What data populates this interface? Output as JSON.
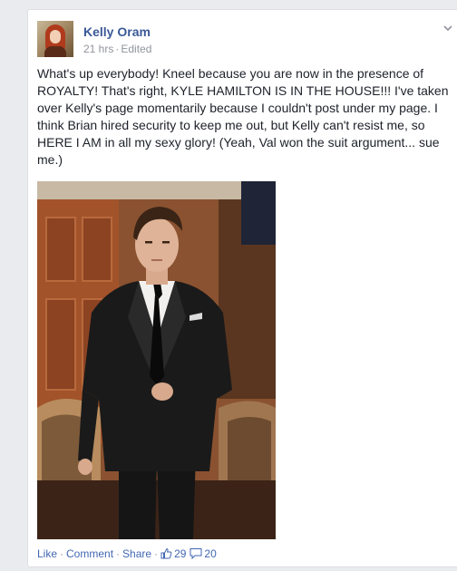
{
  "post": {
    "author": "Kelly Oram",
    "time": "21 hrs",
    "separator": "·",
    "edited": "Edited",
    "text": "What's up everybody! Kneel because you are now in the presence of ROYALTY! That's right, KYLE HAMILTON IS IN THE HOUSE!!! I've taken over Kelly's page momentarily because I couldn't post under my page. I think Brian hired security to keep me out, but Kelly can't resist me, so HERE I AM in all my sexy glory! (Yeah, Val won the suit argument... sue me.)"
  },
  "actions": {
    "like": "Like",
    "comment": "Comment",
    "share": "Share",
    "separator": "·",
    "likes_count": "29",
    "comments_count": "20"
  },
  "icons": {
    "chevron": "chevron-down-icon",
    "like": "thumbs-up-icon",
    "comment": "speech-bubble-icon"
  },
  "colors": {
    "link": "#3b5998",
    "action": "#4267b2",
    "meta": "#90949c",
    "text": "#1d2129",
    "background": "#e9ebee"
  }
}
